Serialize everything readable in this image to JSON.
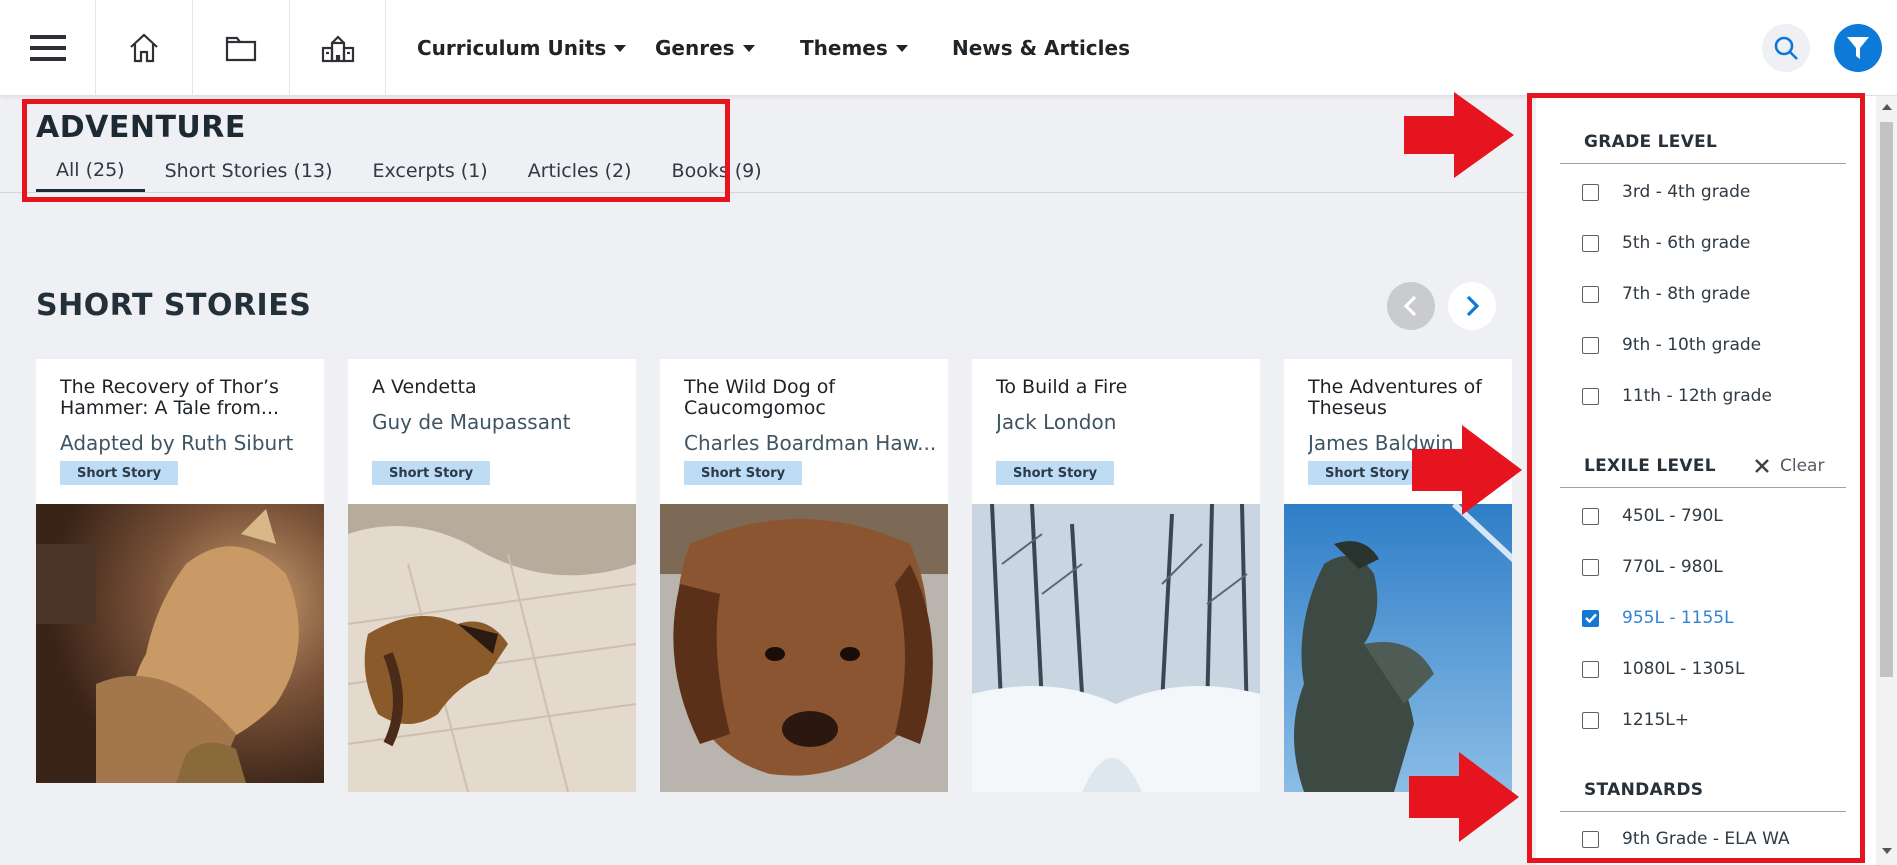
{
  "nav": {
    "links": [
      {
        "label": "Curriculum Units",
        "dropdown": true
      },
      {
        "label": "Genres",
        "dropdown": true
      },
      {
        "label": "Themes",
        "dropdown": true
      },
      {
        "label": "News & Articles",
        "dropdown": false
      }
    ],
    "icons": [
      "hamburger-menu-icon",
      "home-icon",
      "folder-icon",
      "school-icon",
      "search-icon",
      "filter-icon"
    ]
  },
  "page": {
    "title": "ADVENTURE",
    "tabs": [
      {
        "label": "All (25)",
        "active": true
      },
      {
        "label": "Short Stories (13)",
        "active": false
      },
      {
        "label": "Excerpts (1)",
        "active": false
      },
      {
        "label": "Articles (2)",
        "active": false
      },
      {
        "label": "Books (9)",
        "active": false
      }
    ]
  },
  "section": {
    "title": "SHORT STORIES",
    "cards": [
      {
        "title": "The Recovery of Thor’s Hammer: A Tale from...",
        "author": "Adapted by Ruth Siburt",
        "badge": "Short Story",
        "image": "thor-statue-image"
      },
      {
        "title": "A Vendetta",
        "author": "Guy de Maupassant",
        "badge": "Short Story",
        "image": "barking-dog-image"
      },
      {
        "title": "The Wild Dog of Caucomgomoc",
        "author": "Charles Boardman Haw...",
        "badge": "Short Story",
        "image": "bloodhound-image"
      },
      {
        "title": "To Build a Fire",
        "author": "Jack London",
        "badge": "Short Story",
        "image": "snowy-forest-image"
      },
      {
        "title": "The Adventures of Theseus",
        "author": "James Baldwin",
        "badge": "Short Story",
        "image": "theseus-statue-image"
      }
    ]
  },
  "filters": {
    "grade_level": {
      "heading": "GRADE LEVEL",
      "options": [
        {
          "label": "3rd - 4th grade",
          "checked": false
        },
        {
          "label": "5th - 6th grade",
          "checked": false
        },
        {
          "label": "7th - 8th grade",
          "checked": false
        },
        {
          "label": "9th - 10th grade",
          "checked": false
        },
        {
          "label": "11th - 12th grade",
          "checked": false
        }
      ]
    },
    "lexile_level": {
      "heading": "LEXILE LEVEL",
      "clear_label": "Clear",
      "options": [
        {
          "label": "450L - 790L",
          "checked": false
        },
        {
          "label": "770L - 980L",
          "checked": false
        },
        {
          "label": "955L - 1155L",
          "checked": true
        },
        {
          "label": "1080L - 1305L",
          "checked": false
        },
        {
          "label": "1215L+",
          "checked": false
        }
      ]
    },
    "standards": {
      "heading": "STANDARDS",
      "options": [
        {
          "label": "9th Grade - ELA WA",
          "checked": false
        }
      ]
    }
  },
  "colors": {
    "accent": "#0c7ad6",
    "annotation": "#e5141e",
    "badge": "#bfdcf5",
    "background": "#eff0f3"
  }
}
